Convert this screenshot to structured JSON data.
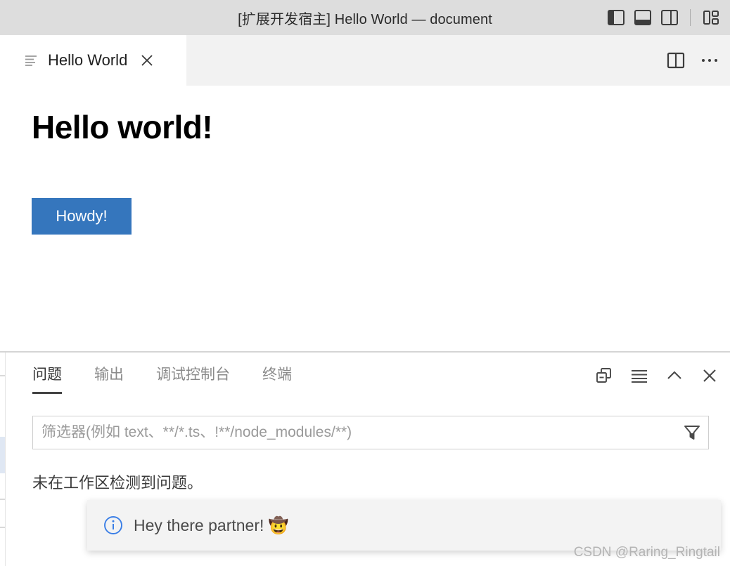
{
  "titlebar": {
    "title": "[扩展开发宿主] Hello World — document",
    "actions": [
      {
        "name": "toggle-primary-sidebar-icon",
        "label": "切换主侧栏"
      },
      {
        "name": "toggle-panel-icon",
        "label": "切换面板"
      },
      {
        "name": "toggle-secondary-sidebar-icon",
        "label": "切换辅助侧栏"
      },
      {
        "name": "customize-layout-icon",
        "label": "自定义布局"
      }
    ]
  },
  "tabbar": {
    "tab": {
      "label": "Hello World",
      "icon": "preview-lines-icon",
      "close_label": "关闭"
    },
    "actions": [
      {
        "name": "split-editor-icon",
        "label": "拆分编辑器"
      },
      {
        "name": "more-actions-icon",
        "label": "更多操作..."
      }
    ]
  },
  "webview": {
    "heading": "Hello world!",
    "button_label": "Howdy!",
    "button_color": "#3576bd"
  },
  "panel": {
    "tabs": [
      {
        "label": "问题",
        "active": true
      },
      {
        "label": "输出",
        "active": false
      },
      {
        "label": "调试控制台",
        "active": false
      },
      {
        "label": "终端",
        "active": false
      }
    ],
    "actions": [
      {
        "name": "collapse-all-icon",
        "label": "全部折叠"
      },
      {
        "name": "view-as-list-icon",
        "label": "以列表形式查看"
      },
      {
        "name": "maximize-panel-icon",
        "label": "最大化面板大小"
      },
      {
        "name": "close-panel-icon",
        "label": "关闭面板"
      }
    ],
    "filter": {
      "value": "",
      "placeholder": "筛选器(例如 text、**/*.ts、!**/node_modules/**)",
      "icon": "funnel-filter-icon"
    },
    "empty_message": "未在工作区检测到问题。"
  },
  "notification": {
    "icon": "info-circle-icon",
    "icon_color": "#3a7ee6",
    "message": "Hey there partner! 🤠"
  },
  "watermark": {
    "text": "CSDN @Raring_Ringtail"
  }
}
